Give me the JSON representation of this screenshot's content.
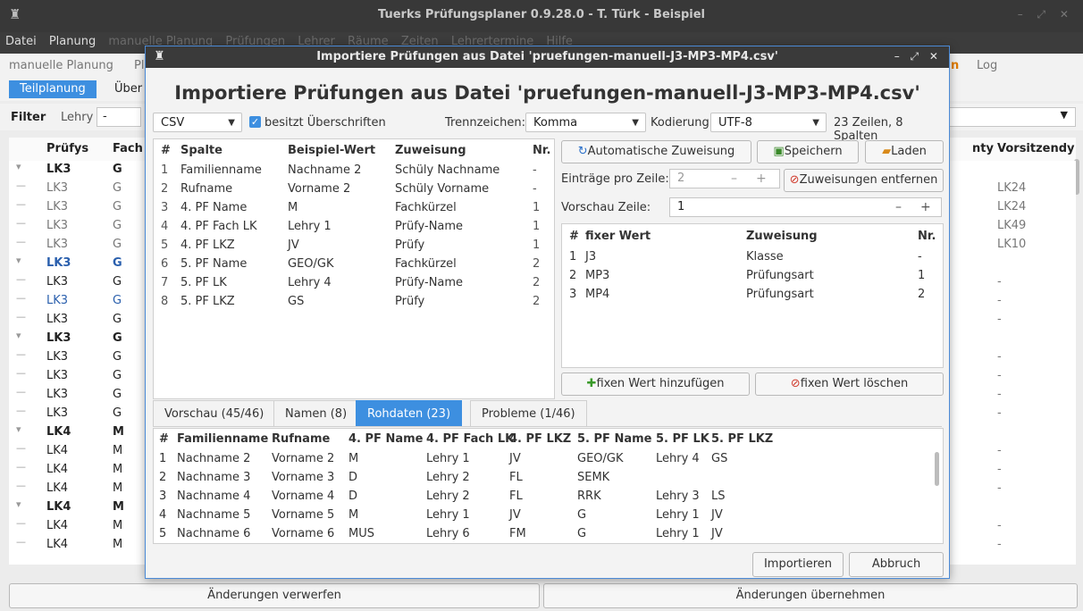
{
  "window": {
    "title": "Tuerks Prüfungsplaner 0.9.28.0 - T. Türk - Beispiel",
    "controls": "– ⤢ ✕"
  },
  "menu": [
    "Datei",
    "Planung",
    "manuelle Planung",
    "Prüfungen",
    "Lehrer",
    "Räume",
    "Zeiten",
    "Lehrertermine",
    "Hilfe"
  ],
  "modebar": {
    "left1": "manuelle Planung",
    "left2": "Pl",
    "right1": "n",
    "right2": "Log"
  },
  "subtabs": {
    "active": "Teilplanung",
    "other": "Über"
  },
  "filter": {
    "label": "Filter",
    "field_label": "Lehry",
    "field_value": "-"
  },
  "table": {
    "headers": {
      "c1": "Prüfys",
      "c2": "Fach",
      "right1": "nty",
      "right2": "Vorsitzendy"
    },
    "rows": [
      {
        "tree": "▾",
        "c1": "LK3",
        "c2": "G",
        "style": "group",
        "r": ""
      },
      {
        "tree": "—",
        "c1": "LK3",
        "c2": "G",
        "style": "dim",
        "r": "LK24"
      },
      {
        "tree": "—",
        "c1": "LK3",
        "c2": "G",
        "style": "dim",
        "r": "LK24"
      },
      {
        "tree": "—",
        "c1": "LK3",
        "c2": "G",
        "style": "dim",
        "r": "LK49"
      },
      {
        "tree": "—",
        "c1": "LK3",
        "c2": "G",
        "style": "dim",
        "r": "LK10"
      },
      {
        "tree": "▾",
        "c1": "LK3",
        "c2": "G",
        "style": "group-blue",
        "r": ""
      },
      {
        "tree": "—",
        "c1": "LK3",
        "c2": "G",
        "style": "normal",
        "r": "-"
      },
      {
        "tree": "—",
        "c1": "LK3",
        "c2": "G",
        "style": "blue",
        "r": "-"
      },
      {
        "tree": "—",
        "c1": "LK3",
        "c2": "G",
        "style": "normal",
        "r": "-"
      },
      {
        "tree": "▾",
        "c1": "LK3",
        "c2": "G",
        "style": "group",
        "r": ""
      },
      {
        "tree": "—",
        "c1": "LK3",
        "c2": "G",
        "style": "normal",
        "r": "-"
      },
      {
        "tree": "—",
        "c1": "LK3",
        "c2": "G",
        "style": "normal",
        "r": "-"
      },
      {
        "tree": "—",
        "c1": "LK3",
        "c2": "G",
        "style": "normal",
        "r": "-"
      },
      {
        "tree": "—",
        "c1": "LK3",
        "c2": "G",
        "style": "normal",
        "r": "-"
      },
      {
        "tree": "▾",
        "c1": "LK4",
        "c2": "M",
        "style": "group",
        "r": ""
      },
      {
        "tree": "—",
        "c1": "LK4",
        "c2": "M",
        "style": "normal",
        "r": "-"
      },
      {
        "tree": "—",
        "c1": "LK4",
        "c2": "M",
        "style": "normal",
        "r": "-"
      },
      {
        "tree": "—",
        "c1": "LK4",
        "c2": "M",
        "style": "normal",
        "r": "-"
      },
      {
        "tree": "▾",
        "c1": "LK4",
        "c2": "M",
        "style": "group",
        "r": ""
      },
      {
        "tree": "—",
        "c1": "LK4",
        "c2": "M",
        "style": "normal",
        "r": "-"
      },
      {
        "tree": "—",
        "c1": "LK4",
        "c2": "M",
        "style": "normal",
        "r": "-"
      }
    ]
  },
  "bottom": {
    "discard": "Änderungen verwerfen",
    "apply": "Änderungen übernehmen"
  },
  "dialog": {
    "title": "Importiere Prüfungen aus Datei 'pruefungen-manuell-J3-MP3-MP4.csv'",
    "controls": "– ⤢ ✕",
    "format": "CSV",
    "has_headers": "besitzt Überschriften",
    "sep_label": "Trennzeichen:",
    "sep_value": "Komma",
    "enc_label": "Kodierung:",
    "enc_value": "UTF-8",
    "summary": "23 Zeilen, 8 Spalten",
    "map_headers": [
      "#",
      "Spalte",
      "Beispiel-Wert",
      "Zuweisung",
      "Nr."
    ],
    "map_rows": [
      [
        "1",
        "Familienname",
        "Nachname 2",
        "Schüly Nachname",
        "-"
      ],
      [
        "2",
        "Rufname",
        "Vorname 2",
        "Schüly Vorname",
        "-"
      ],
      [
        "3",
        "4. PF Name",
        "M",
        "Fachkürzel",
        "1"
      ],
      [
        "4",
        "4. PF Fach LK",
        "Lehry 1",
        "Prüfy-Name",
        "1"
      ],
      [
        "5",
        "4. PF LKZ",
        "JV",
        "Prüfy",
        "1"
      ],
      [
        "6",
        "5. PF Name",
        "GEO/GK",
        "Fachkürzel",
        "2"
      ],
      [
        "7",
        "5. PF LK",
        "Lehry 4",
        "Prüfy-Name",
        "2"
      ],
      [
        "8",
        "5. PF LKZ",
        "GS",
        "Prüfy",
        "2"
      ]
    ],
    "auto_assign": "Automatische Zuweisung",
    "save": "Speichern",
    "load": "Laden",
    "entries_label": "Einträge pro Zeile:",
    "entries_value": "2",
    "remove_assign": "Zuweisungen entfernen",
    "preview_label": "Vorschau Zeile:",
    "preview_value": "1",
    "fixed_headers": [
      "#",
      "fixer Wert",
      "Zuweisung",
      "Nr."
    ],
    "fixed_rows": [
      [
        "1",
        "J3",
        "Klasse",
        "-"
      ],
      [
        "2",
        "MP3",
        "Prüfungsart",
        "1"
      ],
      [
        "3",
        "MP4",
        "Prüfungsart",
        "2"
      ]
    ],
    "add_fixed": "fixen Wert hinzufügen",
    "del_fixed": "fixen Wert löschen",
    "tabs": [
      "Vorschau (45/46)",
      "Namen (8)",
      "Rohdaten (23)",
      "Probleme (1/46)"
    ],
    "raw_headers": [
      "#",
      "Familienname",
      "Rufname",
      "4. PF Name",
      "4. PF Fach LK",
      "4. PF LKZ",
      "5. PF Name",
      "5. PF LK",
      "5. PF LKZ"
    ],
    "raw_rows": [
      [
        "1",
        "Nachname 2",
        "Vorname 2",
        "M",
        "Lehry 1",
        "JV",
        "GEO/GK",
        "Lehry 4",
        "GS"
      ],
      [
        "2",
        "Nachname 3",
        "Vorname 3",
        "D",
        "Lehry 2",
        "FL",
        "SEMK",
        "",
        ""
      ],
      [
        "3",
        "Nachname 4",
        "Vorname 4",
        "D",
        "Lehry 2",
        "FL",
        "RRK",
        "Lehry 3",
        "LS"
      ],
      [
        "4",
        "Nachname 5",
        "Vorname 5",
        "M",
        "Lehry 1",
        "JV",
        "G",
        "Lehry 1",
        "JV"
      ],
      [
        "5",
        "Nachname 6",
        "Vorname 6",
        "MUS",
        "Lehry 6",
        "FM",
        "G",
        "Lehry 1",
        "JV"
      ]
    ],
    "import": "Importieren",
    "cancel": "Abbruch"
  }
}
